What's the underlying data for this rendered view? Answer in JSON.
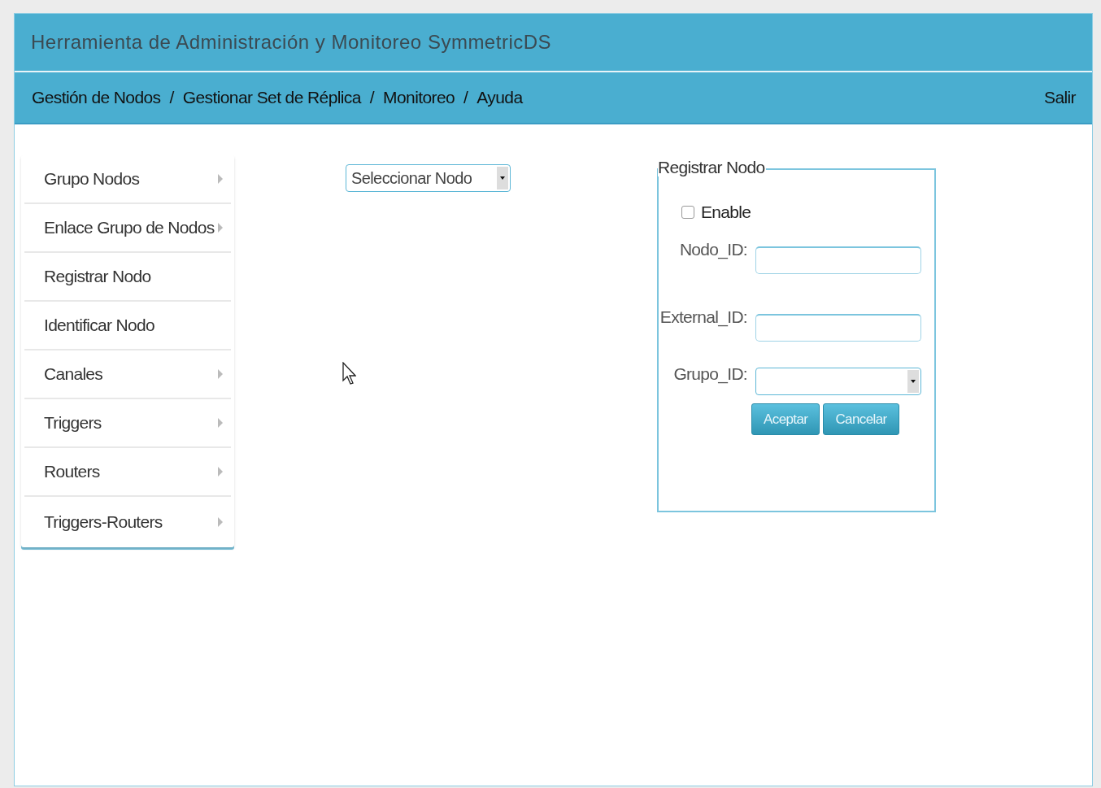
{
  "header": {
    "title": "Herramienta de Administración y Monitoreo SymmetricDS"
  },
  "nav": {
    "items": [
      "Gestión de Nodos",
      "Gestionar Set de Réplica",
      "Monitoreo",
      "Ayuda"
    ],
    "separator": "/",
    "logout": "Salir"
  },
  "sidebar": {
    "items": [
      {
        "label": "Grupo Nodos",
        "has_submenu": true
      },
      {
        "label": "Enlace Grupo de Nodos",
        "has_submenu": true
      },
      {
        "label": "Registrar Nodo",
        "has_submenu": false
      },
      {
        "label": "Identificar Nodo",
        "has_submenu": false
      },
      {
        "label": "Canales",
        "has_submenu": true
      },
      {
        "label": "Triggers",
        "has_submenu": true
      },
      {
        "label": "Routers",
        "has_submenu": true
      },
      {
        "label": "Triggers-Routers",
        "has_submenu": true
      }
    ]
  },
  "node_select": {
    "value": "Seleccionar Nodo"
  },
  "form": {
    "legend": "Registrar Nodo",
    "enable": {
      "label": "Enable",
      "checked": false
    },
    "fields": [
      {
        "label": "Nodo_ID:",
        "kind": "text"
      },
      {
        "label": "External_ID:",
        "kind": "text"
      },
      {
        "label": "Grupo_ID:",
        "kind": "select"
      }
    ],
    "buttons": [
      "Aceptar",
      "Cancelar"
    ]
  }
}
